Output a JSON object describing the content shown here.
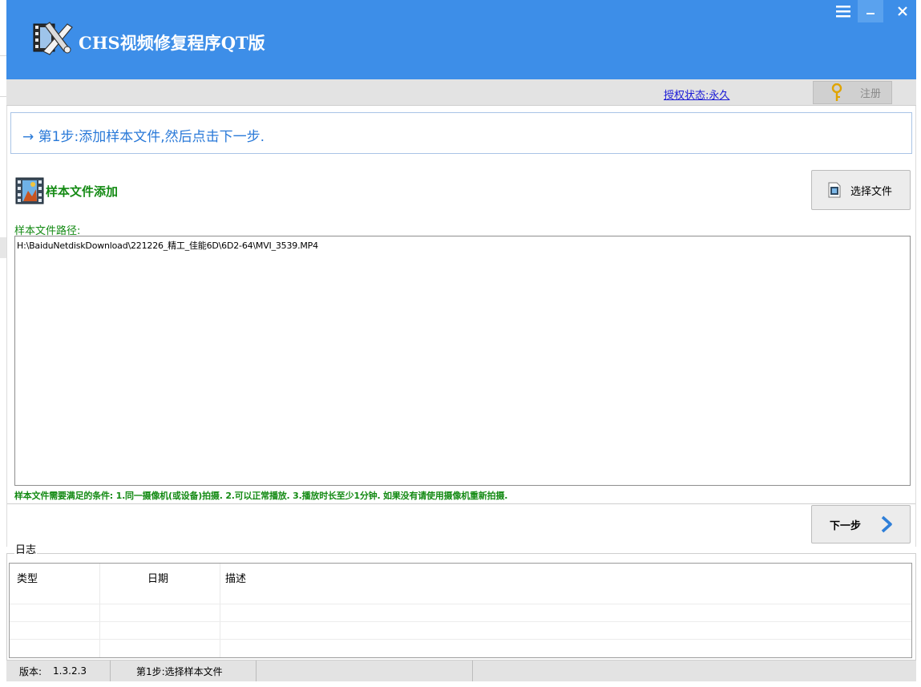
{
  "app": {
    "title": "CHS视频修复程序QT版"
  },
  "window_controls": {
    "menu_icon": "hamburger-icon",
    "minimize_icon": "minimize-icon",
    "close_icon": "close-icon"
  },
  "auth": {
    "status_link": "授权状态:永久",
    "register_label": "注册"
  },
  "step": {
    "text": "→ 第1步:添加样本文件,然后点击下一步."
  },
  "sample": {
    "section_title": "样本文件添加",
    "select_file_label": "选择文件",
    "path_label": "样本文件路径:",
    "path_value": "H:\\BaiduNetdiskDownload\\221226_精工_佳能6D\\6D2-64\\MVI_3539.MP4",
    "conditions": "样本文件需要满足的条件: 1.同一摄像机(或设备)拍摄. 2.可以正常播放. 3.播放时长至少1分钟.  如果没有请使用摄像机重新拍摄."
  },
  "next_button": {
    "label": "下一步"
  },
  "log": {
    "legend": "日志",
    "columns": [
      "类型",
      "日期",
      "描述"
    ]
  },
  "status": {
    "version_key": "版本:",
    "version_value": "1.3.2.3",
    "step_text": "第1步:选择样本文件"
  },
  "colors": {
    "titlebar": "#3d8ee8",
    "accent_blue": "#2979d8",
    "green_text": "#138a13",
    "link": "#1a1ad6"
  }
}
